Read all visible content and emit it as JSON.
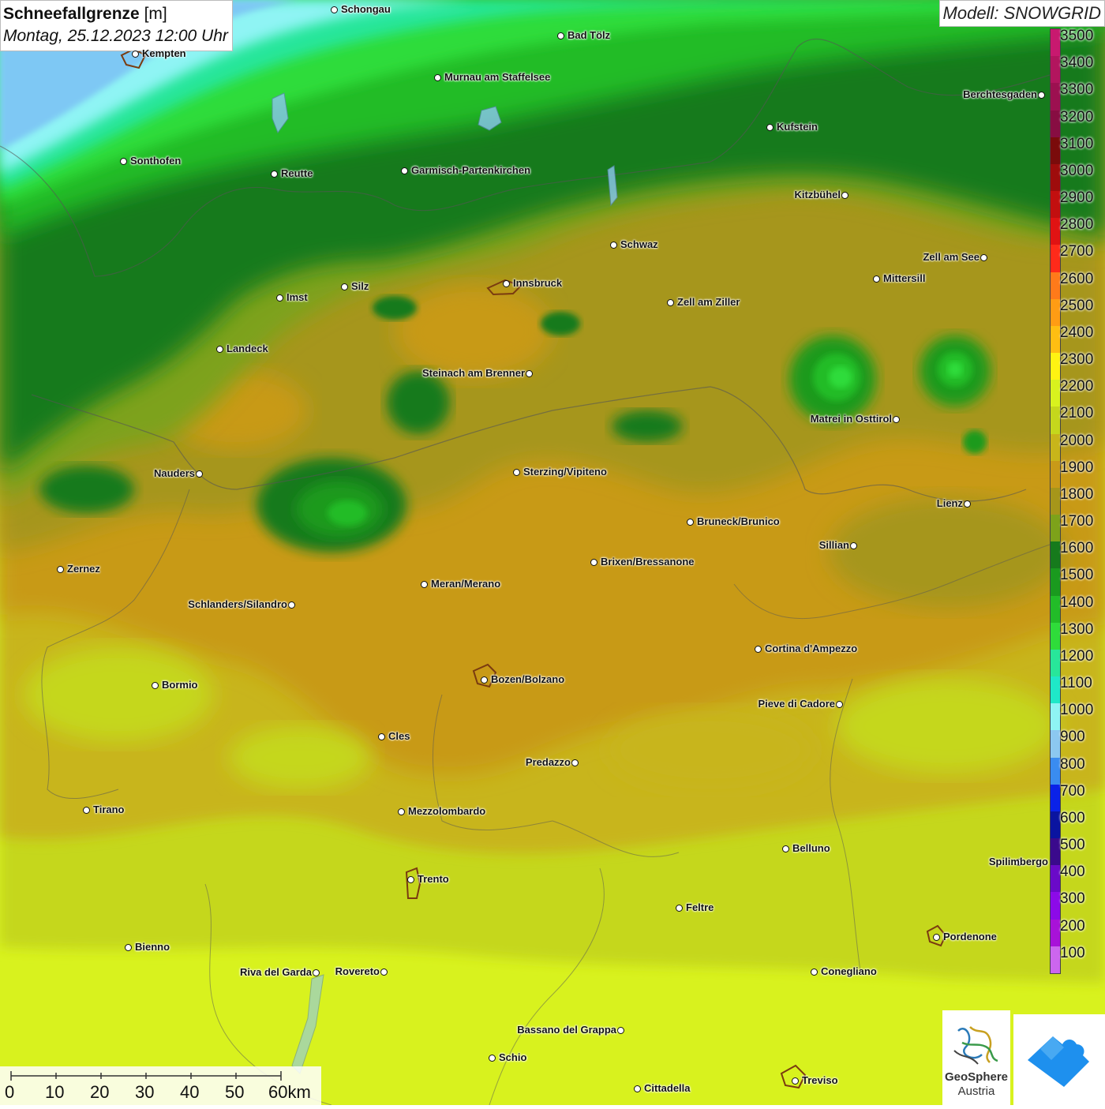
{
  "header": {
    "title_main": "Schneefallgrenze",
    "title_unit": "[m]",
    "datetime": "Montag, 25.12.2023 12:00 Uhr",
    "model": "Modell: SNOWGRID"
  },
  "legend": {
    "steps": [
      {
        "label": "3500",
        "color": "#c8196f"
      },
      {
        "label": "3400",
        "color": "#b2155e"
      },
      {
        "label": "3300",
        "color": "#9c1050"
      },
      {
        "label": "3200",
        "color": "#870d42"
      },
      {
        "label": "3100",
        "color": "#7a0b0b"
      },
      {
        "label": "3000",
        "color": "#9e0c0c"
      },
      {
        "label": "2900",
        "color": "#c20f0f"
      },
      {
        "label": "2800",
        "color": "#e01313"
      },
      {
        "label": "2700",
        "color": "#ff2a1a"
      },
      {
        "label": "2600",
        "color": "#ff7a1a"
      },
      {
        "label": "2500",
        "color": "#ff9c14"
      },
      {
        "label": "2400",
        "color": "#ffbe12"
      },
      {
        "label": "2300",
        "color": "#fff312"
      },
      {
        "label": "2200",
        "color": "#d8f21e"
      },
      {
        "label": "2100",
        "color": "#c5d71c"
      },
      {
        "label": "2000",
        "color": "#c8b51a"
      },
      {
        "label": "1900",
        "color": "#c89a18"
      },
      {
        "label": "1800",
        "color": "#a6961a"
      },
      {
        "label": "1700",
        "color": "#7da21a"
      },
      {
        "label": "1600",
        "color": "#167a1c"
      },
      {
        "label": "1500",
        "color": "#1a9a1e"
      },
      {
        "label": "1400",
        "color": "#22bc28"
      },
      {
        "label": "1300",
        "color": "#2fdc3a"
      },
      {
        "label": "1200",
        "color": "#28e69a"
      },
      {
        "label": "1100",
        "color": "#1fe8c8"
      },
      {
        "label": "1000",
        "color": "#8ff4f4"
      },
      {
        "label": "900",
        "color": "#8cc8f0"
      },
      {
        "label": "800",
        "color": "#3a8cf0"
      },
      {
        "label": "700",
        "color": "#0a22e8"
      },
      {
        "label": "600",
        "color": "#0a14a0"
      },
      {
        "label": "500",
        "color": "#3a0a8c"
      },
      {
        "label": "400",
        "color": "#6a0ac8"
      },
      {
        "label": "300",
        "color": "#8c0ae8"
      },
      {
        "label": "200",
        "color": "#a812d8"
      },
      {
        "label": "100",
        "color": "#cc66ee"
      }
    ]
  },
  "map": {
    "colors": {
      "sky_blue": "#7ec8f4",
      "cyan": "#8ff4f4",
      "teal": "#28e69a",
      "green_bright": "#2fdc3a",
      "green_mid": "#22bc28",
      "green_dark": "#1a9a1e",
      "olive_green": "#7da21a",
      "olive": "#a6961a",
      "orange_brown": "#c89a18",
      "mustard": "#c8b51a",
      "yellow_green": "#c5d71c",
      "lime": "#d8f21e"
    },
    "cities": [
      {
        "name": "Schongau",
        "side": "right"
      },
      {
        "name": "Bad Tölz",
        "side": "right"
      },
      {
        "name": "Kempten",
        "side": "right"
      },
      {
        "name": "Murnau am Staffelsee",
        "side": "right"
      },
      {
        "name": "Berchtesgaden",
        "side": "left"
      },
      {
        "name": "Kufstein",
        "side": "right"
      },
      {
        "name": "Sonthofen",
        "side": "right"
      },
      {
        "name": "Reutte",
        "side": "right"
      },
      {
        "name": "Garmisch-Partenkirchen",
        "side": "right"
      },
      {
        "name": "Kitzbühel",
        "side": "left"
      },
      {
        "name": "Schwaz",
        "side": "right"
      },
      {
        "name": "Zell am See",
        "side": "left"
      },
      {
        "name": "Innsbruck",
        "side": "right"
      },
      {
        "name": "Mittersill",
        "side": "right"
      },
      {
        "name": "Silz",
        "side": "right"
      },
      {
        "name": "Imst",
        "side": "right"
      },
      {
        "name": "Zell am Ziller",
        "side": "right"
      },
      {
        "name": "Landeck",
        "side": "right"
      },
      {
        "name": "Steinach am Brenner",
        "side": "left"
      },
      {
        "name": "Matrei in Osttirol",
        "side": "left"
      },
      {
        "name": "Nauders",
        "side": "left"
      },
      {
        "name": "Sterzing/Vipiteno",
        "side": "right"
      },
      {
        "name": "Lienz",
        "side": "left"
      },
      {
        "name": "Bruneck/Brunico",
        "side": "right"
      },
      {
        "name": "Sillian",
        "side": "left"
      },
      {
        "name": "Zernez",
        "side": "right"
      },
      {
        "name": "Brixen/Bressanone",
        "side": "right"
      },
      {
        "name": "Meran/Merano",
        "side": "right"
      },
      {
        "name": "Schlanders/Silandro",
        "side": "left"
      },
      {
        "name": "Cortina d'Ampezzo",
        "side": "right"
      },
      {
        "name": "Bozen/Bolzano",
        "side": "right"
      },
      {
        "name": "Bormio",
        "side": "right"
      },
      {
        "name": "Pieve di Cadore",
        "side": "left"
      },
      {
        "name": "Cles",
        "side": "right"
      },
      {
        "name": "Predazzo",
        "side": "left"
      },
      {
        "name": "Tirano",
        "side": "right"
      },
      {
        "name": "Mezzolombardo",
        "side": "right"
      },
      {
        "name": "Belluno",
        "side": "right"
      },
      {
        "name": "Spilimbergo",
        "side": "right"
      },
      {
        "name": "Trento",
        "side": "right"
      },
      {
        "name": "Feltre",
        "side": "right"
      },
      {
        "name": "Pordenone",
        "side": "right"
      },
      {
        "name": "Bienno",
        "side": "right"
      },
      {
        "name": "Riva del Garda",
        "side": "left"
      },
      {
        "name": "Rovereto",
        "side": "left"
      },
      {
        "name": "Conegliano",
        "side": "right"
      },
      {
        "name": "Bassano del Grappa",
        "side": "left"
      },
      {
        "name": "Schio",
        "side": "right"
      },
      {
        "name": "Treviso",
        "side": "right"
      },
      {
        "name": "Cittadella",
        "side": "right"
      }
    ]
  },
  "scale": {
    "labels": [
      "0",
      "10",
      "20",
      "30",
      "40",
      "50",
      "60km"
    ]
  },
  "logos": {
    "geosphere_line1": "GeoSphere",
    "geosphere_line2": "Austria"
  }
}
